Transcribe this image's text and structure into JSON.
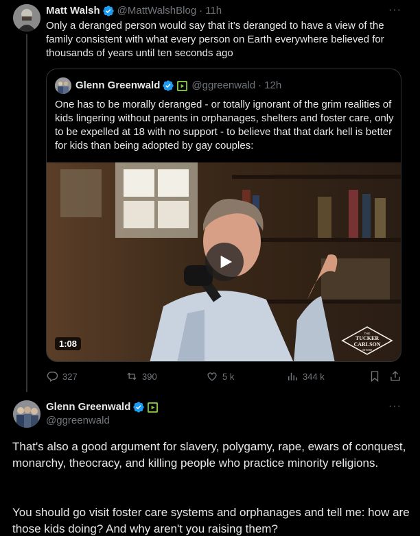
{
  "tweet1": {
    "author_name": "Matt Walsh",
    "author_handle": "@MattWalshBlog",
    "time": "11h",
    "separator": "·",
    "text": "Only a deranged person would say that it’s deranged to have a view of the family consistent with what every person on Earth everywhere believed for thousands of years until ten seconds ago",
    "more": "···",
    "quote": {
      "author_name": "Glenn Greenwald",
      "author_handle": "@ggreenwald",
      "time": "12h",
      "separator": "·",
      "text": "One has to be morally deranged - or totally ignorant of the grim realities of kids lingering without parents in orphanages, shelters and foster care, only to be expelled at 18 with no support - to believe that that dark hell is better for kids than being adopted by gay couples:",
      "video_duration": "1:08",
      "video_logo_lines": [
        "THE",
        "TUCKER",
        "CARLSON",
        "SHOW"
      ]
    },
    "actions": {
      "replies": "327",
      "reposts": "390",
      "likes": "5 k",
      "views": "344 k"
    }
  },
  "tweet2": {
    "author_name": "Glenn Greenwald",
    "author_handle": "@ggreenwald",
    "more": "···",
    "paragraph1": "That's also a good argument for slavery, polygamy, rape, ewars of conquest, monarchy, theocracy, and killing people who practice minority religions.",
    "paragraph2": "You should go visit foster care systems and orphanages and tell me: how are those kids doing? And why aren't you raising them?"
  },
  "colors": {
    "background": "#000000",
    "text_primary": "#e7e9ea",
    "text_secondary": "#71767b",
    "border": "#2f3336",
    "verified_blue": "#1d9bf0",
    "rumble_green": "#85c742"
  },
  "icons": [
    "verified-icon",
    "rumble-badge-icon",
    "more-icon",
    "reply-icon",
    "repost-icon",
    "like-icon",
    "views-icon",
    "bookmark-icon",
    "share-icon",
    "play-icon"
  ]
}
